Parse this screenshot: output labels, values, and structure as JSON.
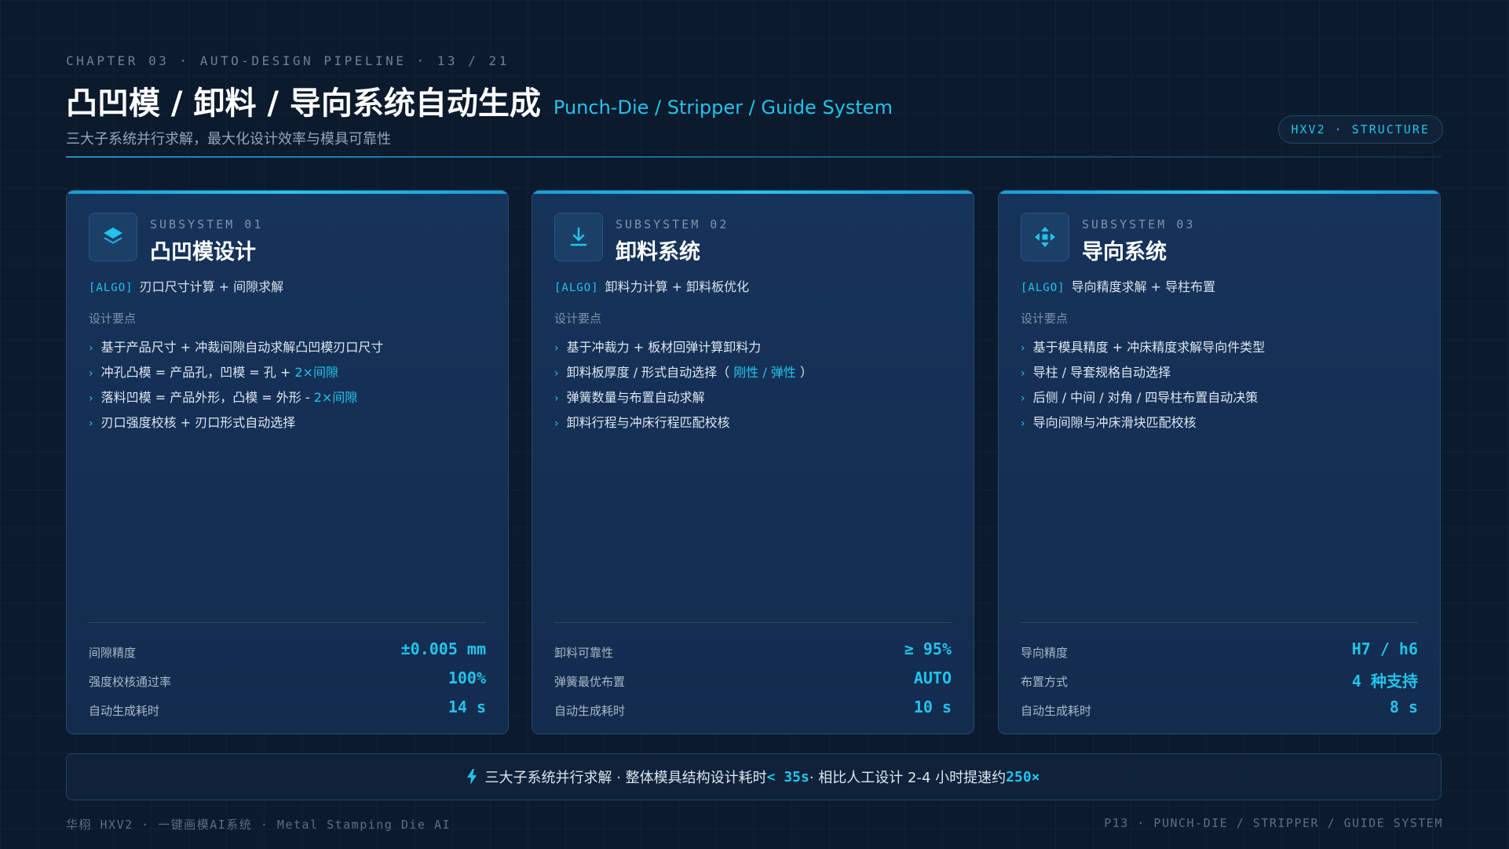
{
  "header": {
    "eyebrow": "CHAPTER 03 · AUTO-DESIGN PIPELINE · 13 / 21",
    "title": "凸凹模 / 卸料 / 导向系统自动生成",
    "title_en": "Punch-Die / Stripper / Guide System",
    "subtitle": "三大子系统并行求解，最大化设计效率与模具可靠性",
    "badge": "HXV2 · STRUCTURE"
  },
  "colors": {
    "accent": "#22c3ec",
    "background": "#0c1a2d",
    "card": "#16335a"
  },
  "cards": [
    {
      "icon": "layers-icon",
      "eyebrow": "SUBSYSTEM 01",
      "title": "凸凹模设计",
      "algo_tag": "[ALGO]",
      "algo": "刃口尺寸计算 + 间隙求解",
      "req_label": "设计要点",
      "points": [
        {
          "text": "基于产品尺寸 + 冲裁间隙自动求解凸凹模刃口尺寸",
          "hl": ""
        },
        {
          "text": "冲孔凸模 = 产品孔，凹模 = 孔 + ",
          "hl": "2×间隙"
        },
        {
          "text": "落料凹模 = 产品外形，凸模 = 外形 - ",
          "hl": "2×间隙"
        },
        {
          "text": "刃口强度校核 + 刃口形式自动选择",
          "hl": ""
        }
      ],
      "metrics": [
        {
          "label": "间隙精度",
          "value": "±0.005 mm"
        },
        {
          "label": "强度校核通过率",
          "value": "100%"
        },
        {
          "label": "自动生成耗时",
          "value": "14 s"
        }
      ]
    },
    {
      "icon": "download-icon",
      "eyebrow": "SUBSYSTEM 02",
      "title": "卸料系统",
      "algo_tag": "[ALGO]",
      "algo": "卸料力计算 + 卸料板优化",
      "req_label": "设计要点",
      "points": [
        {
          "text": "基于冲裁力 + 板材回弹计算卸料力",
          "hl": "",
          "suffix": ""
        },
        {
          "text": "卸料板厚度 / 形式自动选择（",
          "hl": " 刚性 / 弹性 ",
          "suffix": "）"
        },
        {
          "text": "弹簧数量与布置自动求解",
          "hl": "",
          "suffix": ""
        },
        {
          "text": "卸料行程与冲床行程匹配校核",
          "hl": "",
          "suffix": ""
        }
      ],
      "metrics": [
        {
          "label": "卸料可靠性",
          "value": "≥ 95%"
        },
        {
          "label": "弹簧最优布置",
          "value": "AUTO"
        },
        {
          "label": "自动生成耗时",
          "value": "10 s"
        }
      ]
    },
    {
      "icon": "move-arrows-icon",
      "eyebrow": "SUBSYSTEM 03",
      "title": "导向系统",
      "algo_tag": "[ALGO]",
      "algo": "导向精度求解 + 导柱布置",
      "req_label": "设计要点",
      "points": [
        {
          "text": "基于模具精度 + 冲床精度求解导向件类型",
          "hl": ""
        },
        {
          "text": "导柱 / 导套规格自动选择",
          "hl": ""
        },
        {
          "text": "后侧 / 中间 / 对角 / 四导柱布置自动决策",
          "hl": ""
        },
        {
          "text": "导向间隙与冲床滑块匹配校核",
          "hl": ""
        }
      ],
      "metrics": [
        {
          "label": "导向精度",
          "value": "H7 / h6"
        },
        {
          "label": "布置方式",
          "value": "4 种支持"
        },
        {
          "label": "自动生成耗时",
          "value": "8 s"
        }
      ]
    }
  ],
  "banner": {
    "icon": "lightning-icon",
    "text_1": "三大子系统并行求解 · 整体模具结构设计耗时 ",
    "num_1": "< 35s",
    "text_2": " · 相比人工设计 2-4 小时提速约 ",
    "num_2": "250×"
  },
  "footer": {
    "left": "华栩 HXV2 · 一键画模AI系统 · Metal Stamping Die AI",
    "right": "P13 · PUNCH-DIE / STRIPPER / GUIDE SYSTEM"
  }
}
